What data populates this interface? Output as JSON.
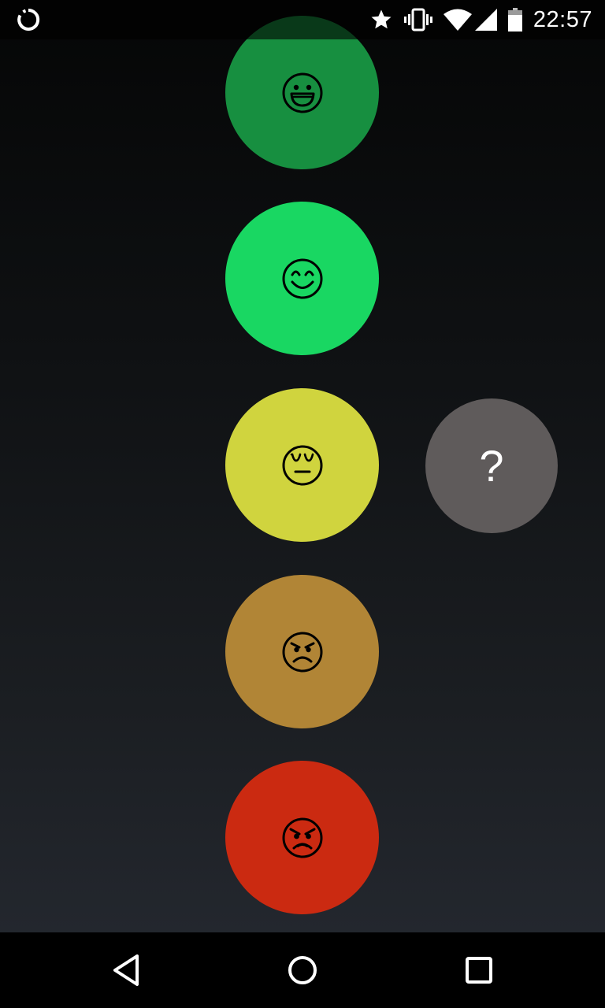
{
  "status_bar": {
    "time": "22:57",
    "left_icon": "sync-ring-icon",
    "icons": [
      "star-icon",
      "vibrate-icon",
      "wifi-icon",
      "cell-signal-icon",
      "battery-icon"
    ]
  },
  "moods": [
    {
      "icon": "grinning-face-icon",
      "color": "#178f40"
    },
    {
      "icon": "smiling-face-icon",
      "color": "#19d762"
    },
    {
      "icon": "unamused-face-icon",
      "color": "#d0d43e"
    },
    {
      "icon": "angry-face-icon",
      "color": "#b18536"
    },
    {
      "icon": "very-angry-face-icon",
      "color": "#cb2a11"
    }
  ],
  "help_button": {
    "label": "?",
    "color": "#5f5b5b"
  },
  "nav_bar": {
    "buttons": [
      "back-icon",
      "home-icon",
      "recents-icon"
    ]
  }
}
